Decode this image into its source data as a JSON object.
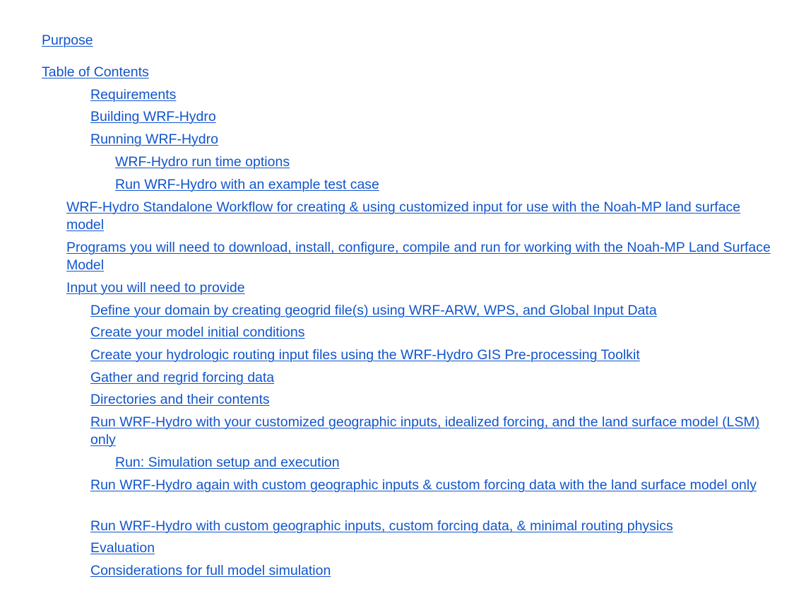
{
  "toc": {
    "items": [
      {
        "label": "Purpose"
      },
      {
        "label": "Table of Contents"
      },
      {
        "label": "Requirements"
      },
      {
        "label": "Building WRF-Hydro"
      },
      {
        "label": "Running WRF-Hydro"
      },
      {
        "label": "WRF-Hydro run time options"
      },
      {
        "label": "Run WRF-Hydro with an example test case"
      },
      {
        "label": "WRF-Hydro Standalone Workflow for creating & using customized input for use with the Noah-MP land surface model"
      },
      {
        "label": "Programs you will need to download, install, configure, compile and run for working with the Noah-MP Land Surface Model"
      },
      {
        "label": "Input you will need to provide"
      },
      {
        "label": "Define your domain by creating geogrid file(s) using WRF-ARW, WPS, and Global Input Data"
      },
      {
        "label": "Create your model initial conditions"
      },
      {
        "label": "Create your hydrologic routing input files using the WRF-Hydro GIS Pre-processing Toolkit"
      },
      {
        "label": "Gather and regrid forcing data"
      },
      {
        "label": "Directories and their contents"
      },
      {
        "label": "Run WRF-Hydro with your customized geographic inputs, idealized forcing, and the land surface model (LSM) only"
      },
      {
        "label": "Run: Simulation setup and execution"
      },
      {
        "label": "Run WRF-Hydro again with custom geographic inputs & custom forcing data with the land surface model only"
      },
      {
        "label": "Run WRF-Hydro with custom geographic inputs, custom forcing data, & minimal routing physics"
      },
      {
        "label": "Evaluation"
      },
      {
        "label": "Considerations for full model simulation"
      }
    ]
  },
  "colors": {
    "link": "#1155cc",
    "background": "#ffffff"
  }
}
